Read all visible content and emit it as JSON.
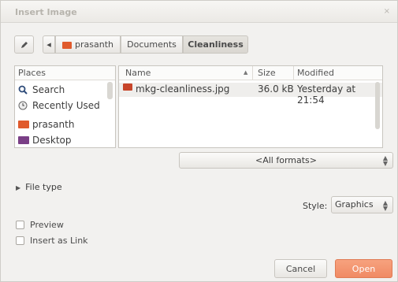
{
  "window": {
    "title": "Insert Image",
    "close": "×"
  },
  "path": {
    "back": "◂",
    "home": "prasanth",
    "docs": "Documents",
    "current": "Cleanliness"
  },
  "places": {
    "header": "Places",
    "items": [
      {
        "label": "Search",
        "icon": "search-icon"
      },
      {
        "label": "Recently Used",
        "icon": "clock-icon"
      },
      {
        "label": "prasanth",
        "icon": "home-folder-icon"
      },
      {
        "label": "Desktop",
        "icon": "desktop-icon"
      }
    ]
  },
  "files": {
    "columns": {
      "name": "Name",
      "size": "Size",
      "modified": "Modified"
    },
    "rows": [
      {
        "name": "mkg-cleanliness.jpg",
        "size": "36.0 kB",
        "modified": "Yesterday at 21:54"
      }
    ]
  },
  "formats": {
    "selected": "<All formats>"
  },
  "filetype": {
    "label": "File type"
  },
  "style": {
    "label": "Style:",
    "value": "Graphics"
  },
  "options": {
    "preview": "Preview",
    "insert_link": "Insert as Link"
  },
  "buttons": {
    "cancel": "Cancel",
    "open": "Open"
  },
  "colors": {
    "accent": "#f08a64",
    "folder": "#e05a2c"
  }
}
